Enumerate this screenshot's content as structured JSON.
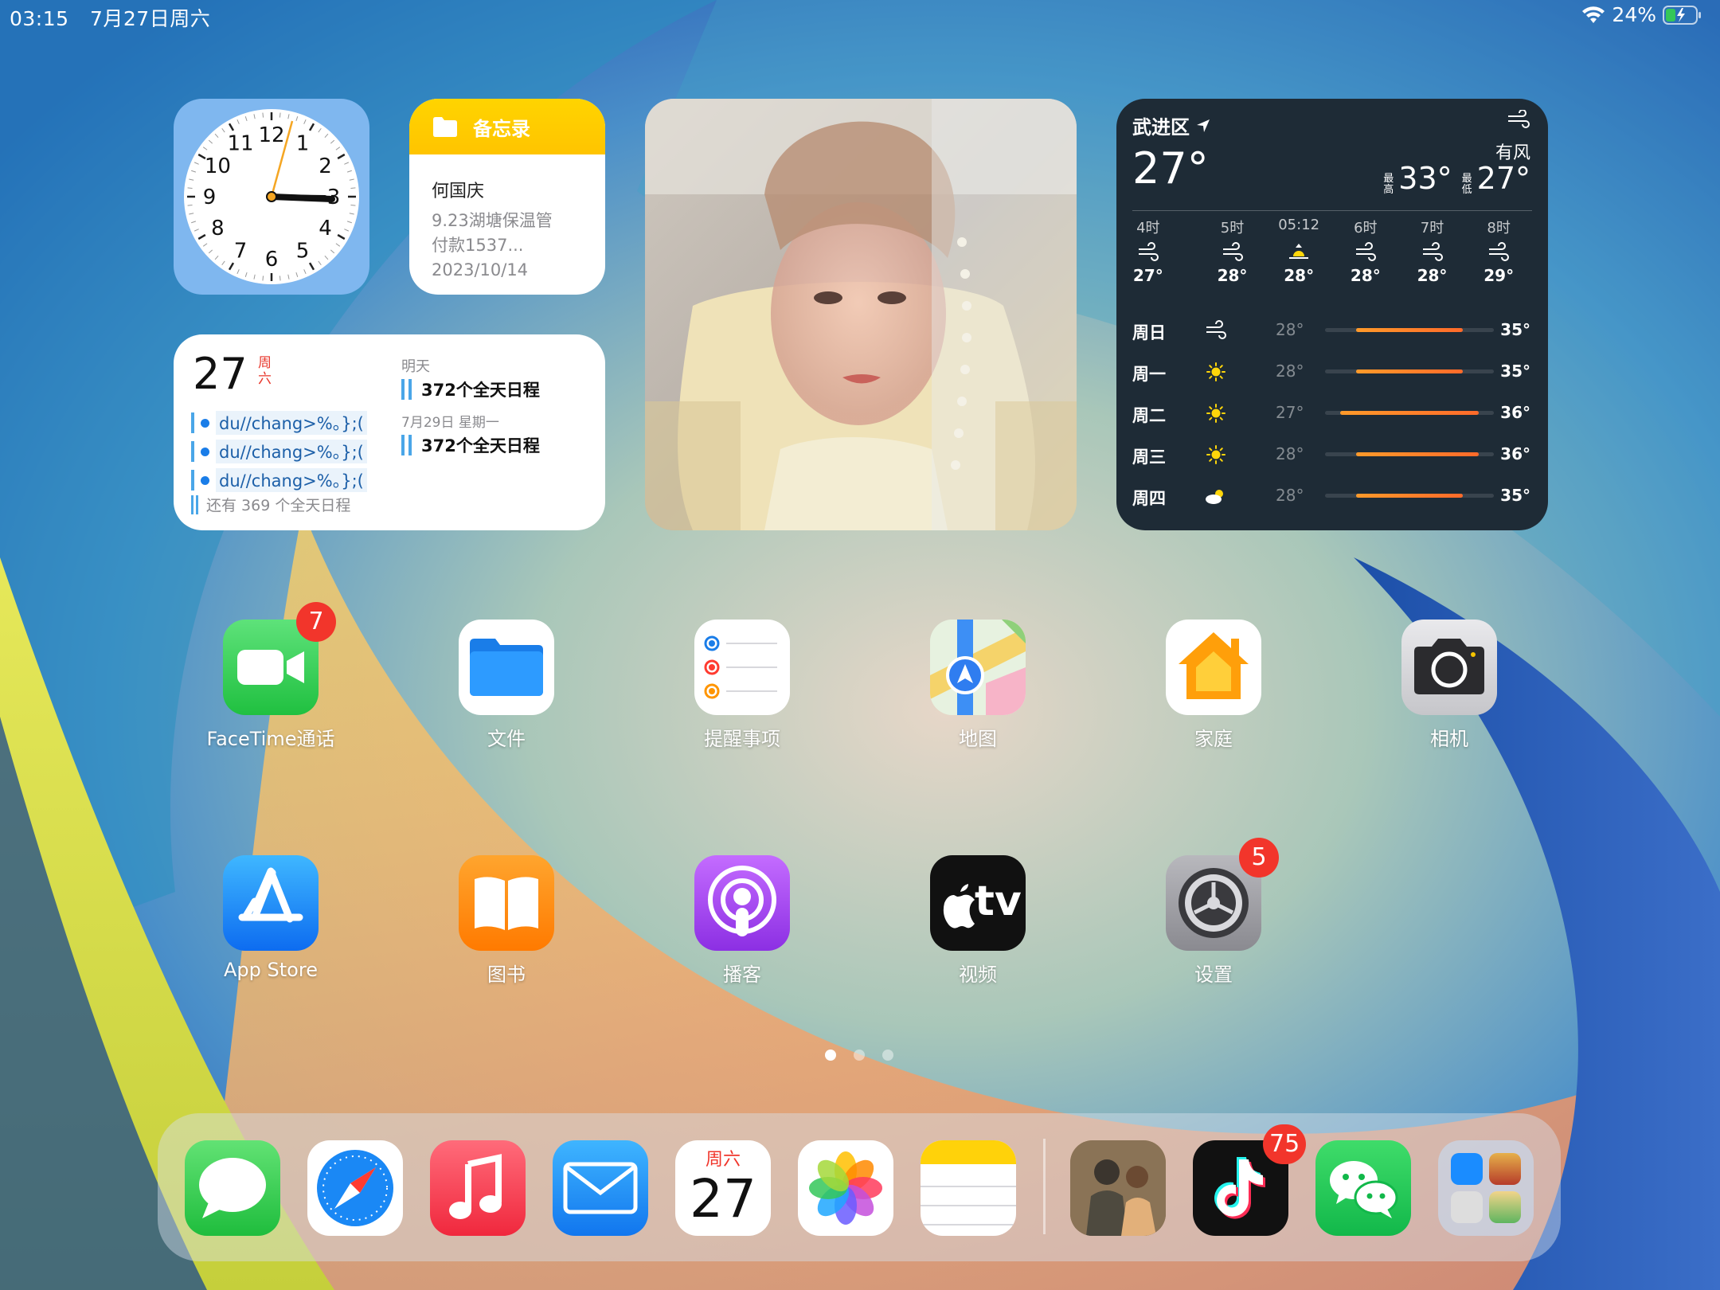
{
  "status_bar": {
    "time": "03:15",
    "date": "7月27日周六",
    "battery": "24%",
    "icons": [
      "wifi-icon",
      "battery-charging-icon"
    ]
  },
  "clock_widget": {
    "numbers": [
      "12",
      "1",
      "2",
      "3",
      "4",
      "5",
      "6",
      "7",
      "8",
      "9",
      "10",
      "11"
    ]
  },
  "notes_widget": {
    "title": "备忘录",
    "note_title": "何国庆",
    "note_line1": "9.23湖塘保温管",
    "note_line2": "付款1537...",
    "note_date": "2023/10/14"
  },
  "calendar_widget": {
    "day": "27",
    "weekday_line1": "周",
    "weekday_line2": "六",
    "events": [
      "du//chang>%。};(",
      "du//chang>%。};(",
      "du//chang>%。};("
    ],
    "more": "还有 369 个全天日程",
    "tomorrow_label": "明天",
    "tomorrow_event": "372个全天日程",
    "later_label": "7月29日 星期一",
    "later_event": "372个全天日程"
  },
  "weather_widget": {
    "location": "武进区",
    "temp": "27°",
    "condition": "有风",
    "high_label_1": "最",
    "high_label_2": "高",
    "high": "33°",
    "low_label_1": "最",
    "low_label_2": "低",
    "low": "27°",
    "hourly": [
      {
        "time": "4时",
        "icon": "wind-icon",
        "temp": "27°"
      },
      {
        "time": "5时",
        "icon": "wind-icon",
        "temp": "28°"
      },
      {
        "time": "05:12",
        "icon": "sunrise-icon",
        "temp": "28°"
      },
      {
        "time": "6时",
        "icon": "wind-icon",
        "temp": "28°"
      },
      {
        "time": "7时",
        "icon": "wind-icon",
        "temp": "28°"
      },
      {
        "time": "8时",
        "icon": "wind-icon",
        "temp": "29°"
      }
    ],
    "daily": [
      {
        "day": "周日",
        "icon": "wind-icon",
        "low": "28°",
        "high": "35°"
      },
      {
        "day": "周一",
        "icon": "sun-icon",
        "low": "28°",
        "high": "35°"
      },
      {
        "day": "周二",
        "icon": "sun-icon",
        "low": "27°",
        "high": "36°"
      },
      {
        "day": "周三",
        "icon": "sun-icon",
        "low": "28°",
        "high": "36°"
      },
      {
        "day": "周四",
        "icon": "partly-cloudy-icon",
        "low": "28°",
        "high": "35°"
      }
    ]
  },
  "apps_row1": [
    {
      "label": "FaceTime通话",
      "badge": "7",
      "color": "#2fd15a"
    },
    {
      "label": "文件",
      "badge": null,
      "color": "#ffffff"
    },
    {
      "label": "提醒事项",
      "badge": null,
      "color": "#ffffff"
    },
    {
      "label": "地图",
      "badge": null,
      "color": "#e8f0e0"
    },
    {
      "label": "家庭",
      "badge": null,
      "color": "#ffffff"
    },
    {
      "label": "相机",
      "badge": null,
      "color": "#d8d8d8"
    }
  ],
  "apps_row2": [
    {
      "label": "App Store",
      "badge": null,
      "color": "#1a8cff"
    },
    {
      "label": "图书",
      "badge": null,
      "color": "#ff8a00"
    },
    {
      "label": "播客",
      "badge": null,
      "color": "#a64bf4"
    },
    {
      "label": "视频",
      "badge": null,
      "color": "#111111"
    },
    {
      "label": "设置",
      "badge": "5",
      "color": "#8e8e93"
    }
  ],
  "appletv_text": "tv",
  "dock": {
    "calendar_weekday": "周六",
    "calendar_day": "27",
    "tiktok_badge": "75"
  },
  "page_dots": 3
}
